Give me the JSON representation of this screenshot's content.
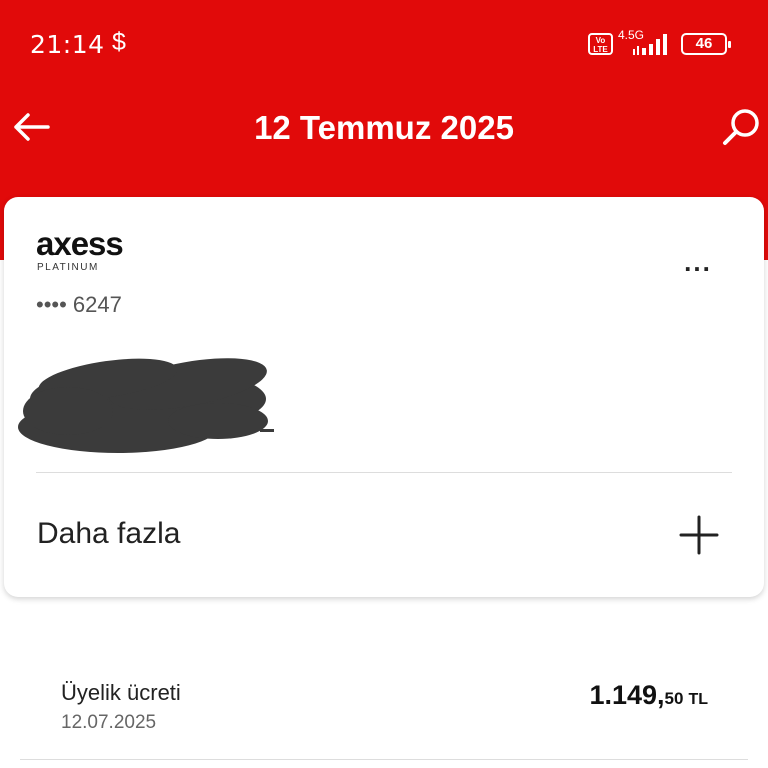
{
  "status_bar": {
    "time": "21:14",
    "app_glyph": "$",
    "volte_label": "Vo LTE",
    "network": "4.5G",
    "battery": "46"
  },
  "appbar": {
    "title": "12 Temmuz 2025",
    "back_icon": "arrow-left-icon",
    "search_icon": "search-icon"
  },
  "card": {
    "brand": "axess",
    "brand_sub": "PLATINUM",
    "more_label": "...",
    "number": "•••• 6247",
    "expand_label": "Daha fazla",
    "expand_icon": "plus-icon"
  },
  "transaction": {
    "title": "Üyelik ücreti",
    "date": "12.07.2025",
    "amount_main": "1.149,",
    "amount_decimal": "50",
    "currency": "TL"
  },
  "colors": {
    "brand_red": "#e10a0a",
    "text_dark": "#222222",
    "text_muted": "#666666"
  }
}
